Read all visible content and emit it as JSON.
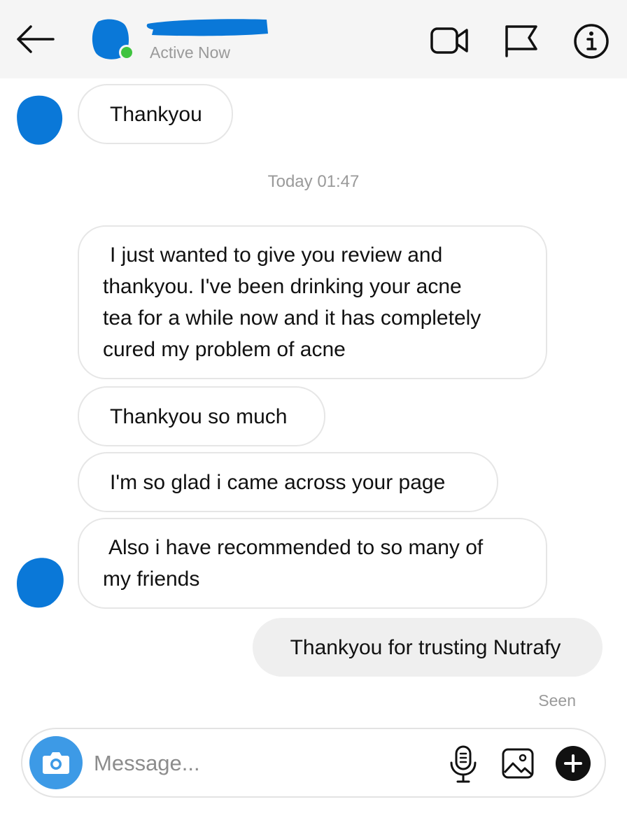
{
  "header": {
    "status": "Active Now",
    "status_color": "#3fc33f",
    "redaction_color": "#0a78d8",
    "icons": [
      "back-arrow-icon",
      "video-call-icon",
      "flag-icon",
      "info-icon"
    ]
  },
  "messages": {
    "incoming_1": "Thankyou",
    "timestamp": "Today 01:47",
    "review_lines": [
      "I just wanted to give you review and",
      "thankyou. I've been drinking your acne",
      "tea for a while now and it has completely",
      "cured my problem of acne"
    ],
    "thanks_so_much": "Thankyou so much",
    "glad": "I'm so glad i came across your page",
    "recommend_lines": [
      "Also i have recommended to so many of",
      "my friends"
    ],
    "outgoing": "Thankyou for trusting Nutrafy",
    "seen": "Seen"
  },
  "composer": {
    "placeholder": "Message...",
    "icons": [
      "camera-icon",
      "microphone-icon",
      "image-icon",
      "plus-icon"
    ],
    "camera_color": "#3d9ae6"
  }
}
